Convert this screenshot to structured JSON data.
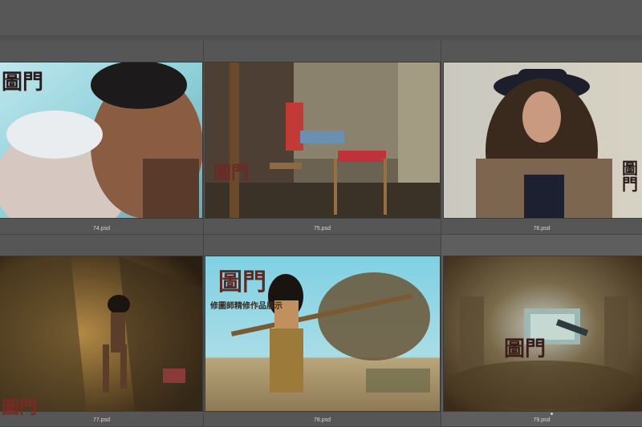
{
  "files": [
    {
      "name": "74.psd"
    },
    {
      "name": "75.psd"
    },
    {
      "name": "76.psd"
    },
    {
      "name": "77.psd"
    },
    {
      "name": "78.psd"
    },
    {
      "name": "79.psd"
    }
  ],
  "watermark": {
    "logo_text": "圖門",
    "caption": "修圖師精修作品展示"
  },
  "colors": {
    "background": "#555555",
    "cell": "#565656",
    "label": "#d8d8d8"
  }
}
